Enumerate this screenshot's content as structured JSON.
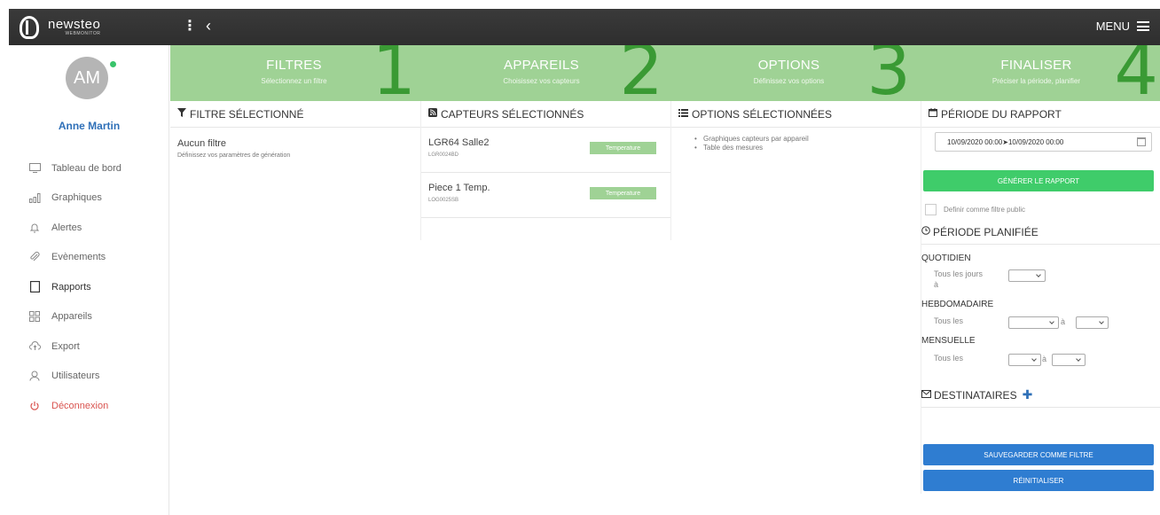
{
  "app": {
    "logo_name": "newsteo",
    "logo_sub": "WEBMONITOR"
  },
  "topbar": {
    "dots": "⋮",
    "back": "‹",
    "menu_label": "MENU"
  },
  "user": {
    "initials": "AM",
    "name": "Anne Martin"
  },
  "nav": [
    {
      "label": "Tableau de bord",
      "icon": "monitor-icon"
    },
    {
      "label": "Graphiques",
      "icon": "bar-chart-icon"
    },
    {
      "label": "Alertes",
      "icon": "bell-icon"
    },
    {
      "label": "Evènements",
      "icon": "paperclip-icon"
    },
    {
      "label": "Rapports",
      "icon": "document-icon",
      "active": true
    },
    {
      "label": "Appareils",
      "icon": "grid-icon"
    },
    {
      "label": "Export",
      "icon": "cloud-icon"
    },
    {
      "label": "Utilisateurs",
      "icon": "user-icon"
    },
    {
      "label": "Déconnexion",
      "icon": "power-icon"
    }
  ],
  "wizard": [
    {
      "title": "FILTRES",
      "sub": "Sélectionnez un filtre",
      "num": "1"
    },
    {
      "title": "APPAREILS",
      "sub": "Choisissez vos capteurs",
      "num": "2"
    },
    {
      "title": "OPTIONS",
      "sub": "Définissez vos options",
      "num": "3"
    },
    {
      "title": "FINALISER",
      "sub": "Préciser la période, planifier",
      "num": "4"
    }
  ],
  "filter_col": {
    "header": "FILTRE SÉLECTIONNÉ",
    "title": "Aucun filtre",
    "sub": "Définissez vos paramètres de génération"
  },
  "sensors_col": {
    "header": "CAPTEURS SÉLECTIONNÉS",
    "items": [
      {
        "name": "LGR64 Salle2",
        "code": "LGR0024BD",
        "badge": "Temperature"
      },
      {
        "name": "Piece 1 Temp.",
        "code": "LOG0025SB",
        "badge": "Temperature"
      }
    ]
  },
  "options_col": {
    "header": "OPTIONS SÉLECTIONNÉES",
    "items": [
      "Graphiques capteurs par appareil",
      "Table des mesures"
    ]
  },
  "final_col": {
    "header": "PÉRIODE DU RAPPORT",
    "date_range": "10/09/2020 00:00➤10/09/2020 00:00",
    "generate": "GÉNÉRER LE RAPPORT",
    "public_filter": "Definir comme filtre public",
    "scheduled_header": "PÉRIODE PLANIFIÉE",
    "daily": "QUOTIDIEN",
    "daily_text": "Tous les jours",
    "daily_a": "à",
    "weekly": "HEBDOMADAIRE",
    "weekly_text": "Tous les",
    "weekly_a": "à",
    "monthly": "MENSUELLE",
    "monthly_text": "Tous les",
    "monthly_a": "à",
    "recipients": "DESTINATAIRES",
    "save_filter": "SAUVEGARDER COMME FILTRE",
    "reset": "RÉINITIALISER"
  },
  "colors": {
    "wizard_bg": "#9fd295",
    "wizard_num": "#3a9a34",
    "generate": "#3fcc6a",
    "blue_btn": "#2f7dd1",
    "name_blue": "#2f70b8",
    "logout": "#d9534f"
  }
}
